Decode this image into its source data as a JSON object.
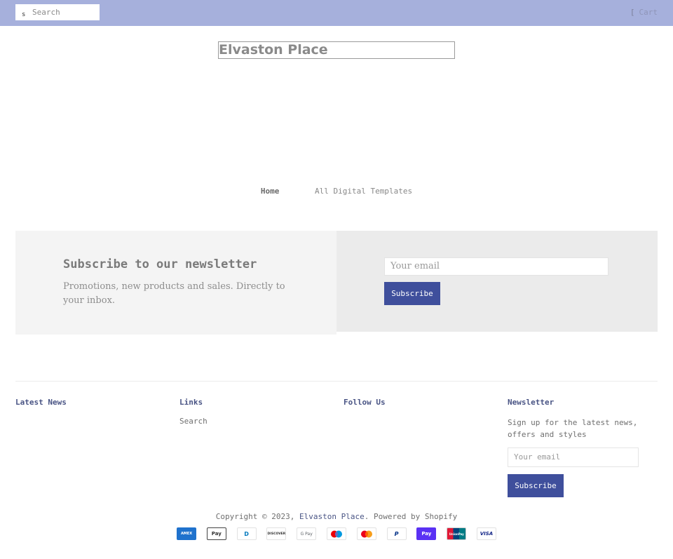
{
  "header": {
    "search_placeholder": "Search",
    "search_icon_glyph": "s",
    "cart_bracket": "[",
    "cart_label": "Cart"
  },
  "logo": {
    "text": "Elvaston Place"
  },
  "nav": {
    "items": [
      {
        "label": "Home"
      },
      {
        "label": "All Digital Templates"
      }
    ]
  },
  "newsletter": {
    "title": "Subscribe to our newsletter",
    "description": "Promotions, new products and sales. Directly to your inbox.",
    "email_placeholder": "Your email",
    "button_label": "Subscribe"
  },
  "footer": {
    "latest_news": {
      "title": "Latest News"
    },
    "links": {
      "title": "Links",
      "items": [
        {
          "label": "Search"
        }
      ]
    },
    "follow_us": {
      "title": "Follow Us"
    },
    "newsletter": {
      "title": "Newsletter",
      "text": "Sign up for the latest news, offers and styles",
      "email_placeholder": "Your email",
      "button_label": "Subscribe"
    },
    "copyright_prefix": "Copyright © 2023,",
    "store_name": "Elvaston Place",
    "powered_by": ". Powered by Shopify",
    "payments": [
      {
        "label": "AMEX",
        "icon": "amex-icon"
      },
      {
        "label": "Pay",
        "icon": "apple-pay-icon"
      },
      {
        "label": "D",
        "icon": "diners-club-icon"
      },
      {
        "label": "DISCOVER",
        "icon": "discover-icon"
      },
      {
        "label": "G Pay",
        "icon": "google-pay-icon"
      },
      {
        "label": "",
        "icon": "maestro-icon"
      },
      {
        "label": "",
        "icon": "mastercard-icon"
      },
      {
        "label": "P",
        "icon": "paypal-icon"
      },
      {
        "label": "Pay",
        "icon": "shop-pay-icon"
      },
      {
        "label": "UnionPay",
        "icon": "unionpay-icon"
      },
      {
        "label": "VISA",
        "icon": "visa-icon"
      }
    ]
  },
  "colors": {
    "topbar": "#a6b0dc",
    "accent": "#3f4f9c",
    "heading_link": "#4a5585"
  }
}
